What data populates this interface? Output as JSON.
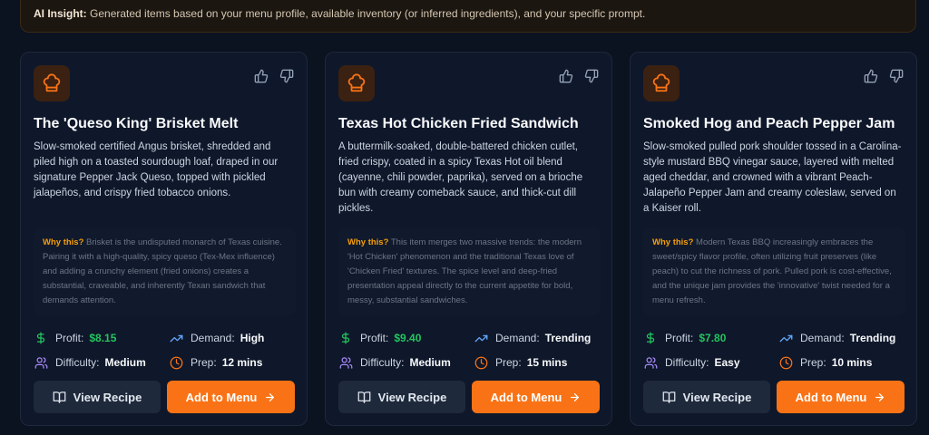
{
  "insight": {
    "label": "AI Insight:",
    "text": " Generated items based on your menu profile, available inventory (or inferred ingredients), and your specific prompt."
  },
  "labels": {
    "why": "Why this?",
    "profit": "Profit:",
    "demand": "Demand:",
    "difficulty": "Difficulty:",
    "prep": "Prep:",
    "view_recipe": "View Recipe",
    "add_to_menu": "Add to Menu"
  },
  "colors": {
    "accent": "#f97316",
    "profit": "#22c55e",
    "why_label": "#f59e0b",
    "card_bg": "#0f172a"
  },
  "icons": {
    "card": "chef-hat-icon",
    "like": "thumbs-up-icon",
    "dislike": "thumbs-down-icon",
    "profit": "dollar-icon",
    "demand": "trending-up-icon",
    "difficulty": "users-icon",
    "prep": "clock-icon",
    "view_recipe": "book-open-icon",
    "add_to_menu": "arrow-right-icon"
  },
  "cards": [
    {
      "title": "The 'Queso King' Brisket Melt",
      "description": "Slow-smoked certified Angus brisket, shredded and piled high on a toasted sourdough loaf, draped in our signature Pepper Jack Queso, topped with pickled jalapeños, and crispy fried tobacco onions.",
      "why": " Brisket is the undisputed monarch of Texas cuisine. Pairing it with a high-quality, spicy queso (Tex-Mex influence) and adding a crunchy element (fried onions) creates a substantial, craveable, and inherently Texan sandwich that demands attention.",
      "profit": "$8.15",
      "demand": "High",
      "difficulty": "Medium",
      "prep": "12 mins"
    },
    {
      "title": "Texas Hot Chicken Fried Sandwich",
      "description": "A buttermilk-soaked, double-battered chicken cutlet, fried crispy, coated in a spicy Texas Hot oil blend (cayenne, chili powder, paprika), served on a brioche bun with creamy comeback sauce, and thick-cut dill pickles.",
      "why": " This item merges two massive trends: the modern 'Hot Chicken' phenomenon and the traditional Texas love of 'Chicken Fried' textures. The spice level and deep-fried presentation appeal directly to the current appetite for bold, messy, substantial sandwiches.",
      "profit": "$9.40",
      "demand": "Trending",
      "difficulty": "Medium",
      "prep": "15 mins"
    },
    {
      "title": "Smoked Hog and Peach Pepper Jam",
      "description": "Slow-smoked pulled pork shoulder tossed in a Carolina-style mustard BBQ vinegar sauce, layered with melted aged cheddar, and crowned with a vibrant Peach-Jalapeño Pepper Jam and creamy coleslaw, served on a Kaiser roll.",
      "why": " Modern Texas BBQ increasingly embraces the sweet/spicy flavor profile, often utilizing fruit preserves (like peach) to cut the richness of pork. Pulled pork is cost-effective, and the unique jam provides the 'innovative' twist needed for a menu refresh.",
      "profit": "$7.80",
      "demand": "Trending",
      "difficulty": "Easy",
      "prep": "10 mins"
    }
  ]
}
